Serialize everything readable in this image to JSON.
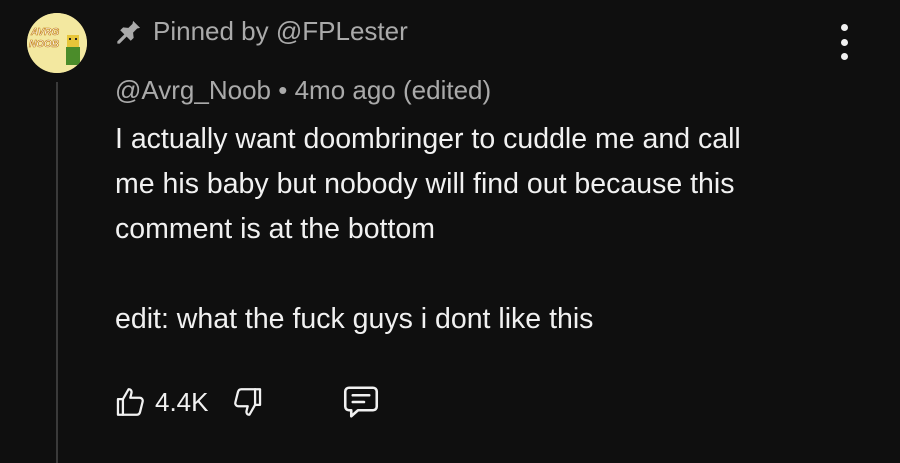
{
  "comment": {
    "pinned_text": "Pinned by @FPLester",
    "author": "@Avrg_Noob",
    "separator": "•",
    "time": "4mo ago",
    "edited": "(edited)",
    "body_lines": [
      "I actually want doombringer to cuddle me and call",
      "me his baby but nobody will find out because this",
      "comment is at the bottom",
      "edit: what the fuck guys i dont like this"
    ],
    "like_count": "4.4K",
    "avatar_text": [
      "AVRG",
      "NOOB"
    ]
  },
  "icons": {
    "pin": "pin-icon",
    "menu": "more-vertical-icon",
    "like": "thumbs-up-icon",
    "dislike": "thumbs-down-icon",
    "reply": "comment-icon"
  },
  "colors": {
    "background": "#0f0f0f",
    "primary_text": "#f1f1f1",
    "secondary_text": "#aaaaaa",
    "thread_line": "#3a3a3a",
    "avatar_bg": "#f3e8a0"
  }
}
